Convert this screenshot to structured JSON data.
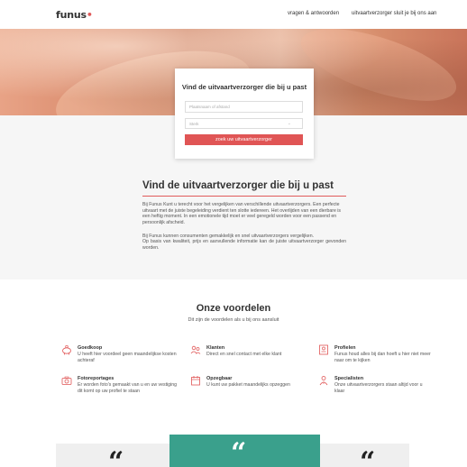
{
  "header": {
    "logo": "funus",
    "logo_dot": "•",
    "nav": [
      "vragen & antwoorden",
      "uitvaartverzorger sluit je bij ons aan"
    ]
  },
  "search": {
    "title": "Vind de uitvaartverzorger die bij u past",
    "location_placeholder": "Plaatsnaam of afstand",
    "select_value": "Sterk",
    "button_label": "zoek uw uitvaartverzorger"
  },
  "intro": {
    "title": "Vind de uitvaartverzorger die bij u past",
    "p1": "Bij Funus Kunt u terecht voor het vergelijken van verschillende uitvaartverzorgers. Een perfecte uitvaart met de juiste begeleiding verdient ten slotte iedereen. Het overlijden van een dierbare is een heftig moment. In een emotionele tijd moet er veel geregeld worden voor een passend en persoonlijk afscheid.",
    "p2": "Bij Funus kunnen consumenten gemakkelijk en snel uitvaartverzorgers vergelijken.",
    "p3": "Op basis van kwaliteit, prijs en aanvullende informatie kan de juiste uitvaartverzorger gevonden worden."
  },
  "advantages": {
    "title": "Onze voordelen",
    "subtitle": "Dit zijn de voordelen als u bij ons aansluit",
    "items": [
      {
        "title": "Goedkoop",
        "desc": "U heeft hier voordeel geen maandelijkse kosten achteraf",
        "icon": "piggy-bank-icon"
      },
      {
        "title": "Klanten",
        "desc": "Direct en snel contact met elke klant",
        "icon": "users-icon"
      },
      {
        "title": "Profielen",
        "desc": "Funus houd alles bij dan hoeft u hier niet meer naar om te kijken",
        "icon": "profile-icon"
      },
      {
        "title": "Fotoreportages",
        "desc": "Er worden foto's gemaakt van u en uw vestiging dit komt op uw profiel te staan",
        "icon": "camera-icon"
      },
      {
        "title": "Opzegbaar",
        "desc": "U kunt uw pakket maandelijks opzeggen",
        "icon": "calendar-icon"
      },
      {
        "title": "Specialisten",
        "desc": "Onze uitvaartverzorgers staan altijd voor u klaar",
        "icon": "specialist-icon"
      }
    ]
  },
  "testimonials": {
    "quote_mark": "“"
  },
  "colors": {
    "accent": "#e05555",
    "teal": "#3aa08c"
  }
}
